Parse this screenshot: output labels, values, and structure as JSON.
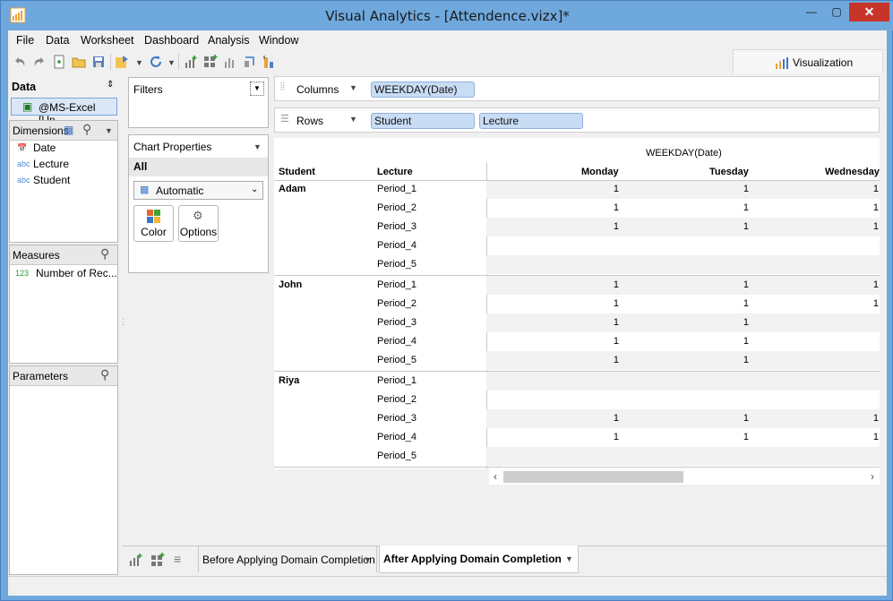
{
  "window": {
    "title": "Visual Analytics - [Attendence.vizx]*",
    "minimize": "—",
    "maximize": "▢",
    "close": "✕"
  },
  "menu": [
    "File",
    "Data",
    "Worksheet",
    "Dashboard",
    "Analysis",
    "Window"
  ],
  "vis_tab": "Visualization",
  "data_panel": {
    "title": "Data",
    "source": "@MS-Excel [Un..."
  },
  "dimensions": {
    "title": "Dimensions",
    "items": [
      {
        "label": "Date",
        "icon": "calendar-icon"
      },
      {
        "label": "Lecture",
        "icon": "abc"
      },
      {
        "label": "Student",
        "icon": "abc"
      }
    ]
  },
  "measures": {
    "title": "Measures",
    "items": [
      {
        "label": "Number of Rec...",
        "icon": "123"
      }
    ]
  },
  "parameters": {
    "title": "Parameters"
  },
  "filters": {
    "title": "Filters"
  },
  "chart_properties": {
    "title": "Chart Properties",
    "scope": "All",
    "type": "Automatic",
    "color_label": "Color",
    "options_label": "Options"
  },
  "columns_shelf": {
    "label": "Columns",
    "pills": [
      "WEEKDAY(Date)"
    ]
  },
  "rows_shelf": {
    "label": "Rows",
    "pills": [
      "Student",
      "Lecture"
    ]
  },
  "table": {
    "column_group": "WEEKDAY(Date)",
    "row_headers": [
      "Student",
      "Lecture"
    ],
    "columns": [
      "Monday",
      "Tuesday",
      "Wednesday"
    ],
    "groups": [
      {
        "student": "Adam",
        "rows": [
          {
            "lecture": "Period_1",
            "values": [
              "1",
              "1",
              "1"
            ]
          },
          {
            "lecture": "Period_2",
            "values": [
              "1",
              "1",
              "1"
            ]
          },
          {
            "lecture": "Period_3",
            "values": [
              "1",
              "1",
              "1"
            ]
          },
          {
            "lecture": "Period_4",
            "values": [
              "",
              "",
              ""
            ]
          },
          {
            "lecture": "Period_5",
            "values": [
              "",
              "",
              ""
            ]
          }
        ]
      },
      {
        "student": "John",
        "rows": [
          {
            "lecture": "Period_1",
            "values": [
              "1",
              "1",
              "1"
            ]
          },
          {
            "lecture": "Period_2",
            "values": [
              "1",
              "1",
              "1"
            ]
          },
          {
            "lecture": "Period_3",
            "values": [
              "1",
              "1",
              ""
            ]
          },
          {
            "lecture": "Period_4",
            "values": [
              "1",
              "1",
              ""
            ]
          },
          {
            "lecture": "Period_5",
            "values": [
              "1",
              "1",
              ""
            ]
          }
        ]
      },
      {
        "student": "Riya",
        "rows": [
          {
            "lecture": "Period_1",
            "values": [
              "",
              "",
              ""
            ]
          },
          {
            "lecture": "Period_2",
            "values": [
              "",
              "",
              ""
            ]
          },
          {
            "lecture": "Period_3",
            "values": [
              "1",
              "1",
              "1"
            ]
          },
          {
            "lecture": "Period_4",
            "values": [
              "1",
              "1",
              "1"
            ]
          },
          {
            "lecture": "Period_5",
            "values": [
              "",
              "",
              ""
            ]
          }
        ]
      }
    ]
  },
  "sheet_tabs": [
    {
      "label": "Before Applying Domain Completion",
      "active": false
    },
    {
      "label": "After Applying Domain Completion",
      "active": true
    }
  ]
}
